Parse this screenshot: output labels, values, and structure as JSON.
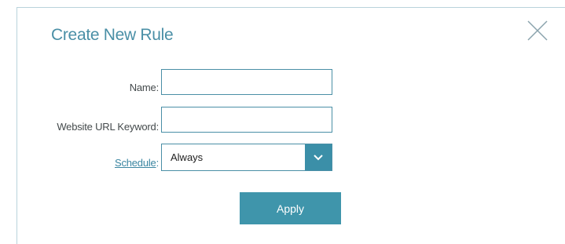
{
  "dialog": {
    "title": "Create New Rule",
    "close_icon": "close-x-icon"
  },
  "form": {
    "name": {
      "label": "Name:",
      "value": "",
      "placeholder": ""
    },
    "url_keyword": {
      "label": "Website URL Keyword:",
      "value": "",
      "placeholder": ""
    },
    "schedule": {
      "label": "Schedule",
      "colon": ":",
      "selected": "Always",
      "dropdown_icon": "chevron-down-icon"
    }
  },
  "actions": {
    "apply_label": "Apply"
  },
  "colors": {
    "accent": "#4a8fa6",
    "button": "#3f95ab",
    "text": "#444a4c"
  }
}
